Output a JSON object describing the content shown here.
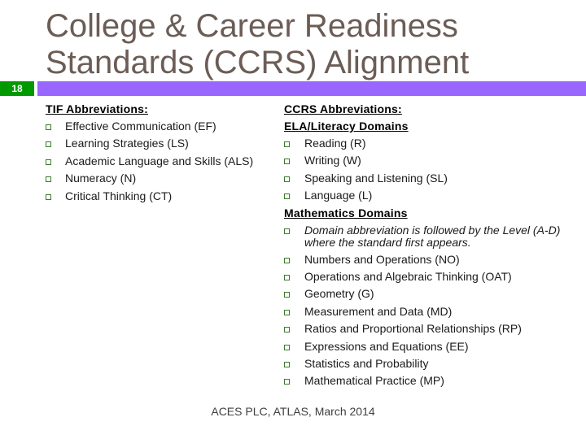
{
  "slide": {
    "title_line1": "College & Career Readiness",
    "title_line2": "Standards (CCRS) Alignment",
    "number": "18",
    "accent_color": "#9966ff",
    "number_color": "#009900",
    "title_color": "#6b5d56"
  },
  "left": {
    "heading": "TIF Abbreviations:",
    "items": [
      "Effective Communication (EF)",
      "Learning Strategies (LS)",
      "Academic Language and Skills (ALS)",
      "Numeracy (N)",
      "Critical Thinking (CT)"
    ]
  },
  "right": {
    "heading": "CCRS Abbreviations:",
    "ela": {
      "heading": "ELA/Literacy Domains",
      "items": [
        "Reading (R)",
        "Writing (W)",
        "Speaking and Listening (SL)",
        "Language (L)"
      ]
    },
    "math": {
      "heading": "Mathematics Domains",
      "note": "Domain abbreviation is followed by the Level (A-D) where the standard first appears.",
      "items": [
        "Numbers and Operations (NO)",
        "Operations and Algebraic Thinking (OAT)",
        "Geometry (G)",
        "Measurement and Data (MD)",
        "Ratios and Proportional Relationships (RP)",
        "Expressions and Equations (EE)",
        "Statistics and Probability",
        "Mathematical Practice (MP)"
      ]
    }
  },
  "footer": "ACES PLC, ATLAS, March 2014"
}
